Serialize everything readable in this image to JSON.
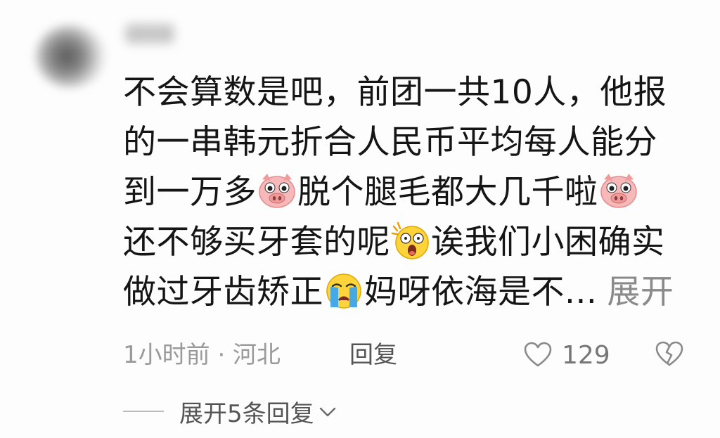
{
  "comment": {
    "avatar_icon": "blurred-avatar-icon",
    "lines": [
      [
        "不会算数是吧，前团一共10人，他报"
      ],
      [
        "的一串韩元折合人民币平均每人能分"
      ],
      [
        "到一万多",
        "脱个腿毛都大几千啦"
      ],
      [
        "还不够买牙套的呢",
        "诶我们小困确实"
      ],
      [
        "做过牙齿矫正",
        "妈呀依海是不...",
        "展开"
      ]
    ],
    "emoji_names": {
      "pig": "pig-face-emoji-icon",
      "shocked": "shocked-face-emoji-icon",
      "crying": "crying-face-emoji-icon"
    }
  },
  "meta": {
    "time_location": "1小时前 · 河北",
    "reply_label": "回复",
    "like_count": "129",
    "like_icon": "heart-outline-icon",
    "dislike_icon": "broken-heart-icon"
  },
  "more_replies": {
    "label": "展开5条回复",
    "icon": "chevron-down-icon"
  },
  "colors": {
    "text": "#151515",
    "muted": "#9a9a9a",
    "secondary": "#555555"
  }
}
